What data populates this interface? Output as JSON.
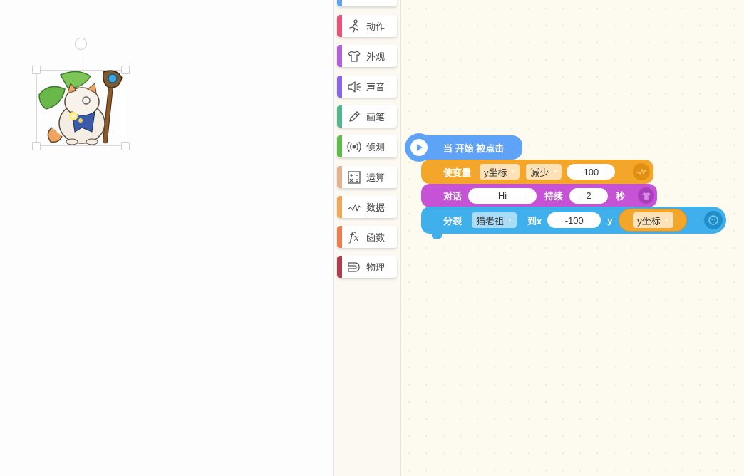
{
  "palette": {
    "categories": [
      {
        "label": "动作",
        "icon": "running-person-icon",
        "color": "#ef4f7b"
      },
      {
        "label": "外观",
        "icon": "tshirt-icon",
        "color": "#b25fe0"
      },
      {
        "label": "声音",
        "icon": "speaker-icon",
        "color": "#8a64f0"
      },
      {
        "label": "画笔",
        "icon": "pencil-icon",
        "color": "#4fb88f"
      },
      {
        "label": "侦测",
        "icon": "radar-icon",
        "color": "#5cbd4c"
      },
      {
        "label": "运算",
        "icon": "calculator-icon",
        "color": "#e4b090"
      },
      {
        "label": "数据",
        "icon": "data-wave-icon",
        "color": "#f0a857"
      },
      {
        "label": "函数",
        "icon": "function-icon",
        "color": "#f07b4d"
      },
      {
        "label": "物理",
        "icon": "magnet-icon",
        "color": "#b33c4a"
      }
    ]
  },
  "script": {
    "hat": {
      "label": "当 开始 被点击",
      "color": "#5ea3f7"
    },
    "set_var": {
      "label": "使变量",
      "var": "y坐标",
      "op": "减少",
      "value": "100",
      "color": "#f4a62a"
    },
    "say": {
      "label": "对话",
      "text": "Hi",
      "duration_label": "持续",
      "duration": "2",
      "unit": "秒",
      "color": "#c653d6"
    },
    "clone": {
      "label": "分裂",
      "sprite": "猫老祖",
      "to_x_label": "到x",
      "x": "-100",
      "y_label": "y",
      "y_reporter": "y坐标",
      "color": "#3fb0ec"
    }
  }
}
